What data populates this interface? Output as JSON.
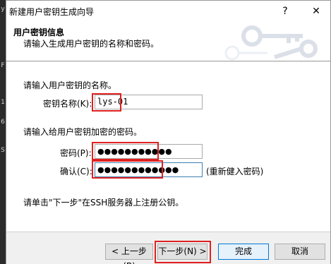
{
  "window": {
    "title": "新建用户密钥生成向导",
    "help_glyph": "?",
    "close_glyph": "✕"
  },
  "background_fragments": [
    "y",
    "F",
    "1",
    "6",
    "S"
  ],
  "banner": {
    "title": "用户密钥信息",
    "subtitle": "请输入生成用户密钥的名称和密码。"
  },
  "name_section": {
    "prompt": "请输入用户密钥的名称。",
    "name_label": "密钥名称(K):",
    "name_value": "lys-01"
  },
  "password_section": {
    "prompt": "请输入给用户密钥加密的密码。",
    "password_label": "密码(P):",
    "password_value": "●●●●●●●●●●●",
    "confirm_label": "确认(C):",
    "confirm_value": "●●●●●●●●●●●●",
    "reenter_hint": "(重新健入密码)"
  },
  "instruction": "请单击\"下一步\"在SSH服务器上注册公钥。",
  "buttons": {
    "back": "< 上一步(B)",
    "next": "下一步(N) >",
    "finish": "完成",
    "cancel": "取消"
  }
}
